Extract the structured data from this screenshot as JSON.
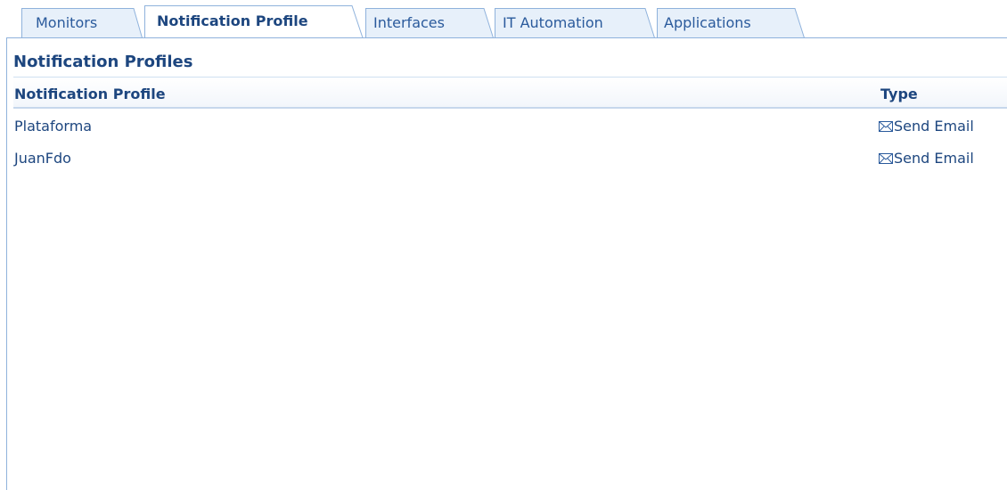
{
  "tabs": [
    {
      "label": "Monitors",
      "active": false
    },
    {
      "label": "Notification Profile",
      "active": true
    },
    {
      "label": "Interfaces",
      "active": false
    },
    {
      "label": "IT Automation",
      "active": false
    },
    {
      "label": "Applications",
      "active": false
    }
  ],
  "section_title": "Notification Profiles",
  "table": {
    "columns": [
      "Notification Profile",
      "Type"
    ],
    "rows": [
      {
        "name": "Plataforma",
        "type": "Send Email",
        "type_icon": "envelope-icon"
      },
      {
        "name": "JuanFdo",
        "type": "Send Email",
        "type_icon": "envelope-icon"
      }
    ]
  },
  "colors": {
    "text_primary": "#1d467f",
    "tab_text": "#2a5a9c",
    "tab_border": "#8fb2dc",
    "tab_fill": "#e7f0fa"
  }
}
